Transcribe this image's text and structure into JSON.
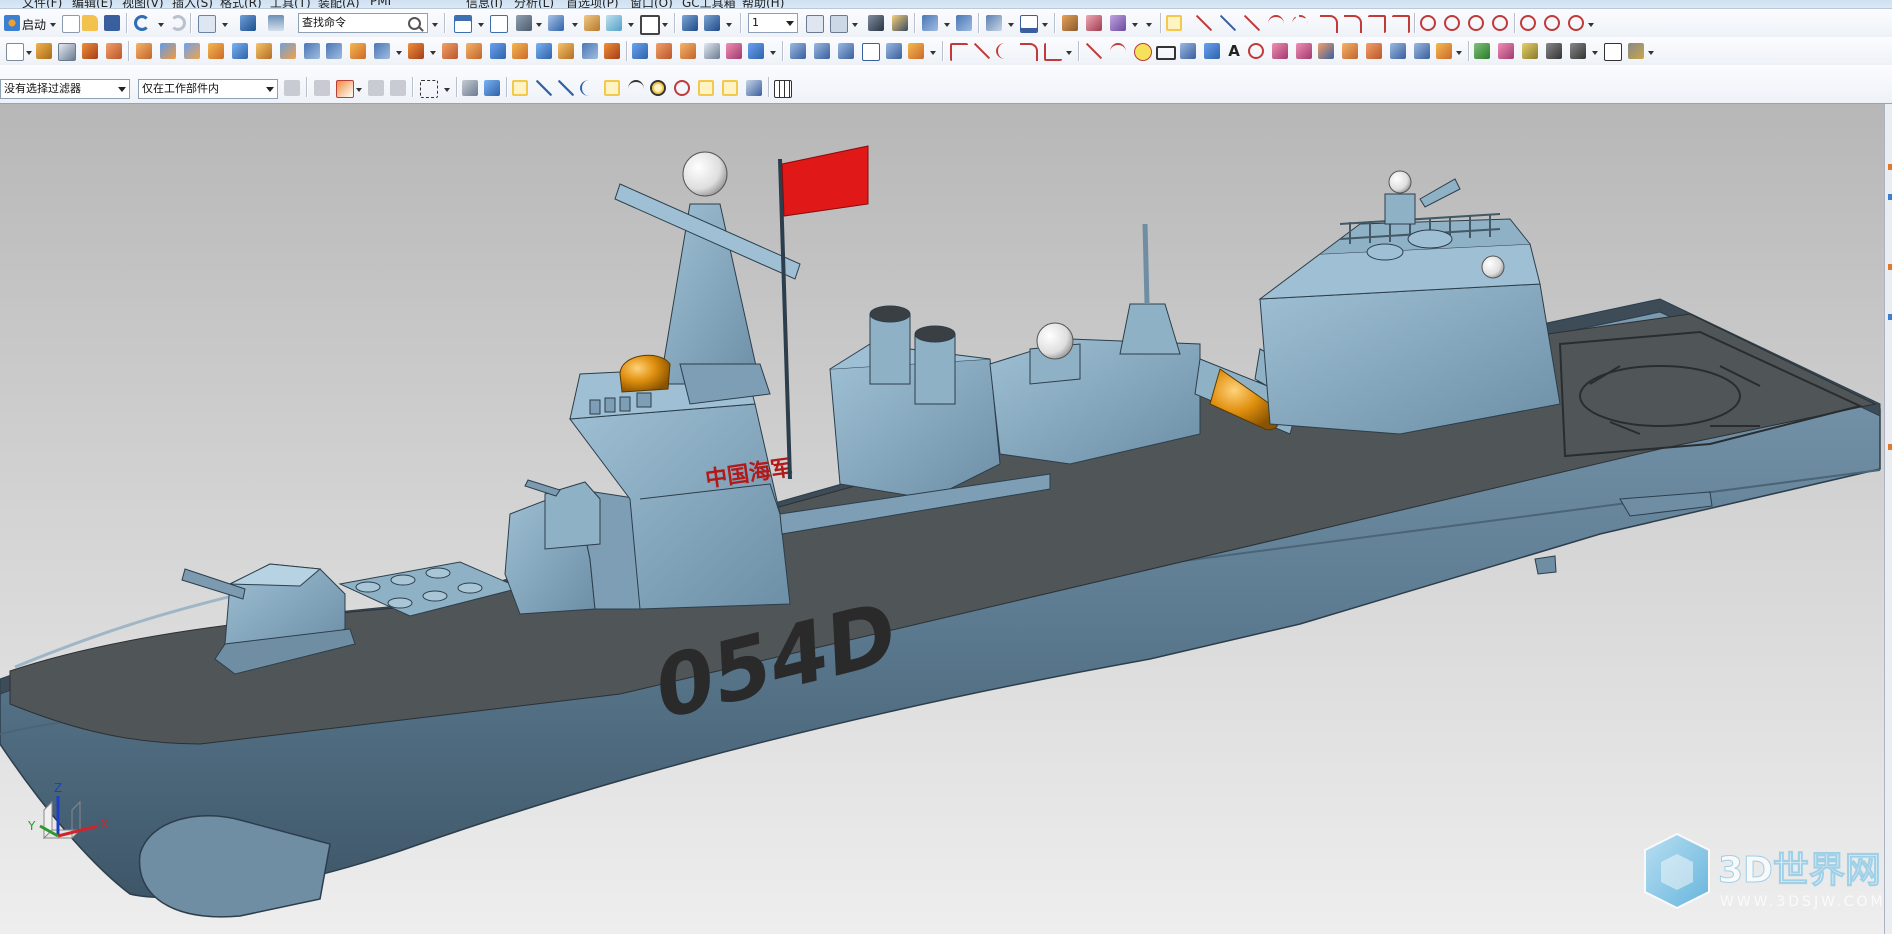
{
  "menubar": {
    "items": [
      "文件(F)",
      "编辑(E)",
      "视图(V)",
      "插入(S)",
      "格式(R)",
      "工具(T)",
      "装配(A)",
      "PMI",
      "信息(I)",
      "分析(L)",
      "首选项(P)",
      "窗口(O)",
      "GC工具箱",
      "帮助(H)"
    ]
  },
  "toolbar": {
    "start_label": "启动",
    "command_finder_placeholder": "查找命令",
    "layer_value": "1",
    "selection_filter": "没有选择过滤器",
    "selection_scope": "仅在工作部件内"
  },
  "viewport": {
    "hull_number": "054D",
    "hull_text": "中国海军",
    "triad": {
      "x": "X",
      "y": "Y",
      "z": "Z"
    },
    "watermark": {
      "brand": "3D世界网",
      "url": "WWW.3DSJW.COM"
    }
  },
  "colors": {
    "hull": "#6b8ba0",
    "deck": "#505558",
    "superstructure": "#8fb1c5",
    "flag": "#e01818",
    "dome_orange": "#d98a0c",
    "toolbar_bg": "#f4f6fa",
    "menubar_bg": "#d6e5f4",
    "viewport_bg": "#d2d2d2"
  },
  "icons": [
    "start-icon",
    "new-file-icon",
    "open-folder-icon",
    "save-icon",
    "undo-icon",
    "redo-icon",
    "search-icon",
    "layer-icon",
    "sketch-icon",
    "extrude-icon",
    "revolve-icon",
    "hole-icon",
    "blend-icon",
    "chamfer-icon",
    "line-icon",
    "arc-icon",
    "circle-icon",
    "rectangle-icon",
    "text-icon",
    "selection-filter-icon",
    "snap-point-icon",
    "wcs-icon"
  ]
}
